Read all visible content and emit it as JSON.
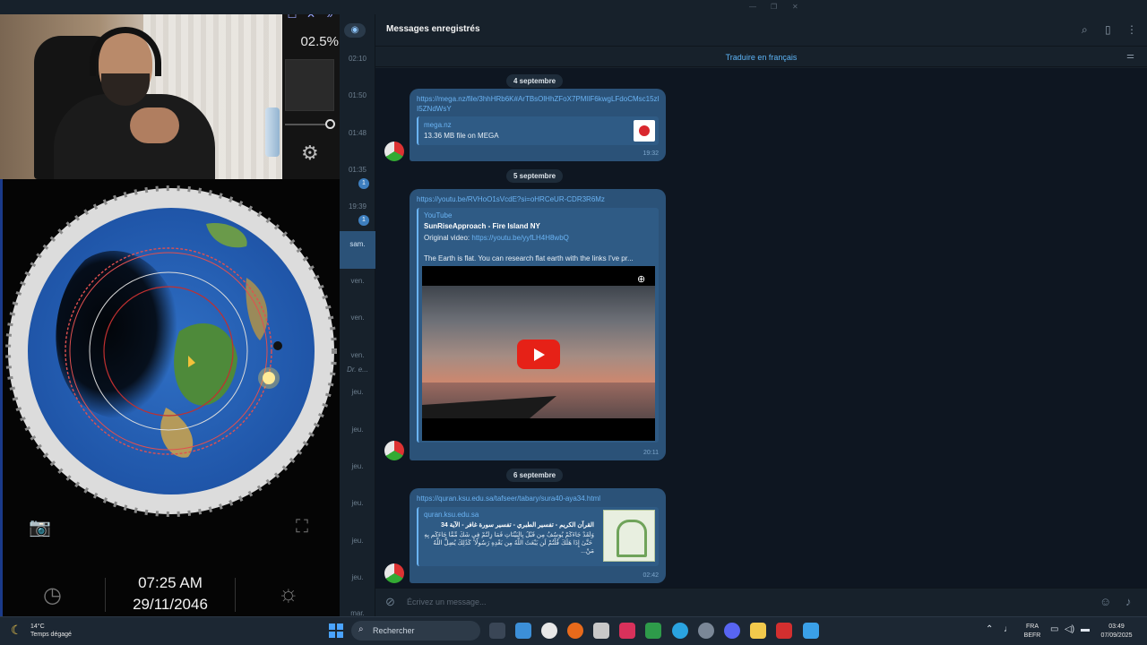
{
  "overlay": {
    "percent": "02.5%",
    "time": "07:25 AM",
    "date": "29/11/2046"
  },
  "telegram": {
    "chat_title": "Messages enregistrés",
    "translate": "Traduire en français",
    "input_placeholder": "Écrivez un message...",
    "chat_list_times": [
      "02:10",
      "01:50",
      "01:48",
      "01:35",
      "19:39",
      "sam.",
      "ven.",
      "ven.",
      "ven.",
      "jeu.",
      "jeu.",
      "jeu.",
      "jeu.",
      "jeu.",
      "jeu.",
      "mar."
    ],
    "chat_list_badges": [
      "1",
      "1"
    ],
    "chat_list_preview": "Dr. e...",
    "dates": [
      "4 septembre",
      "5 septembre",
      "6 septembre"
    ],
    "messages": [
      {
        "link": "https://mega.nz/file/3hhHRb6K#ArTBsOlHhZFoX7PMlIF6kwgLFdoCMsc15zlI5ZNdWsY",
        "site": "mega.nz",
        "title": "13.36 MB file on MEGA",
        "time": "19:32"
      },
      {
        "link": "https://youtu.be/RVHoO1sVcdE?si=oHRCeUR-CDR3R6Mz",
        "site": "YouTube",
        "title": "SunRiseApproach - Fire Island NY",
        "original_label": "Original video:",
        "original_link": "https://youtu.be/yyfLH4H8wbQ",
        "desc": "The Earth is flat. You can research flat earth with the links I've pr...",
        "time": "20:11"
      },
      {
        "link": "https://quran.ksu.edu.sa/tafseer/tabary/sura40-aya34.html",
        "site": "quran.ksu.edu.sa",
        "title": "القرآن الكريم - تفسير الطبري - تفسير سورة غافر - الآية 34",
        "desc": "وَلَقَدْ جَاءَكُمْ يُوسُفُ مِن قَبْلُ بِالْبَيِّنَاتِ فَمَا زِلْتُمْ فِي شَكٍّ مِّمَّا جَاءَكُم بِهِ ۖ حَتَّىٰ إِذَا هَلَكَ قُلْتُمْ لَن يَبْعَثَ اللَّهُ مِن بَعْدِهِ رَسُولًا ۚ كَذَٰلِكَ يُضِلُّ اللَّهُ مَنْ...",
        "time": "02:42"
      }
    ]
  },
  "taskbar": {
    "temp": "14°C",
    "weather": "Temps dégagé",
    "search": "Rechercher",
    "lang1": "FRA",
    "lang2": "BEFR",
    "clock_time": "03:49",
    "clock_date": "07/09/2025"
  },
  "colors": {
    "tg_bg": "#0e1621",
    "bubble": "#2b5278",
    "link": "#6ab3f3",
    "taskbar": "#1c2733"
  }
}
